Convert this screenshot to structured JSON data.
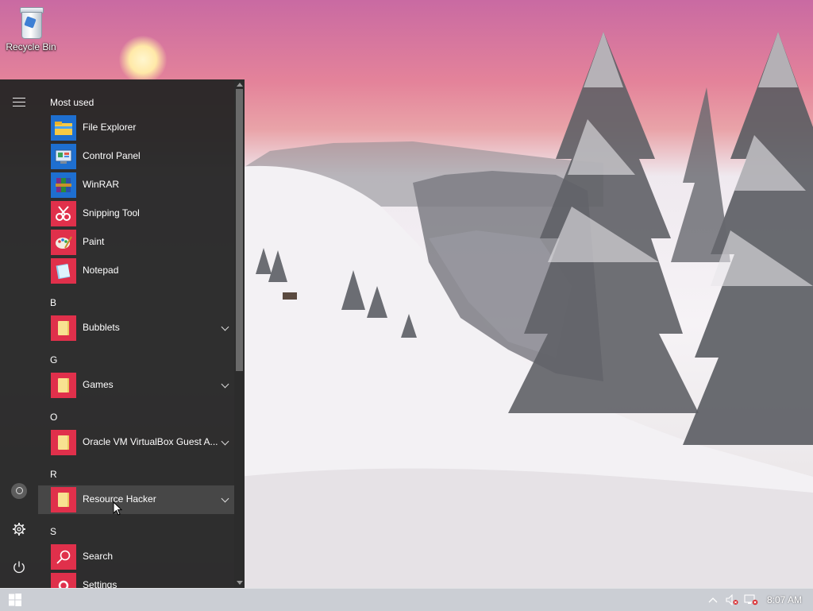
{
  "desktop": {
    "recycle_bin_label": "Recycle Bin"
  },
  "start_menu": {
    "most_used_header": "Most used",
    "most_used": [
      {
        "label": "File Explorer",
        "icon": "file-explorer-icon"
      },
      {
        "label": "Control Panel",
        "icon": "control-panel-icon"
      },
      {
        "label": "WinRAR",
        "icon": "winrar-icon"
      },
      {
        "label": "Snipping Tool",
        "icon": "snipping-tool-icon"
      },
      {
        "label": "Paint",
        "icon": "paint-icon"
      },
      {
        "label": "Notepad",
        "icon": "notepad-icon"
      }
    ],
    "groups": [
      {
        "letter": "B",
        "item": {
          "label": "Bubblets",
          "icon": "folder-icon",
          "expandable": true
        }
      },
      {
        "letter": "G",
        "item": {
          "label": "Games",
          "icon": "folder-icon",
          "expandable": true
        }
      },
      {
        "letter": "O",
        "item": {
          "label": "Oracle VM VirtualBox Guest A...",
          "icon": "folder-icon",
          "expandable": true
        }
      },
      {
        "letter": "R",
        "item": {
          "label": "Resource Hacker",
          "icon": "folder-icon",
          "expandable": true,
          "hovered": true
        }
      },
      {
        "letter": "S",
        "items": [
          {
            "label": "Search",
            "icon": "search-icon"
          },
          {
            "label": "Settings",
            "icon": "settings-icon"
          }
        ]
      }
    ]
  },
  "taskbar": {
    "clock": "8:07 AM"
  },
  "colors": {
    "tile_red": "#e0304b",
    "menu_bg": "#242424"
  }
}
